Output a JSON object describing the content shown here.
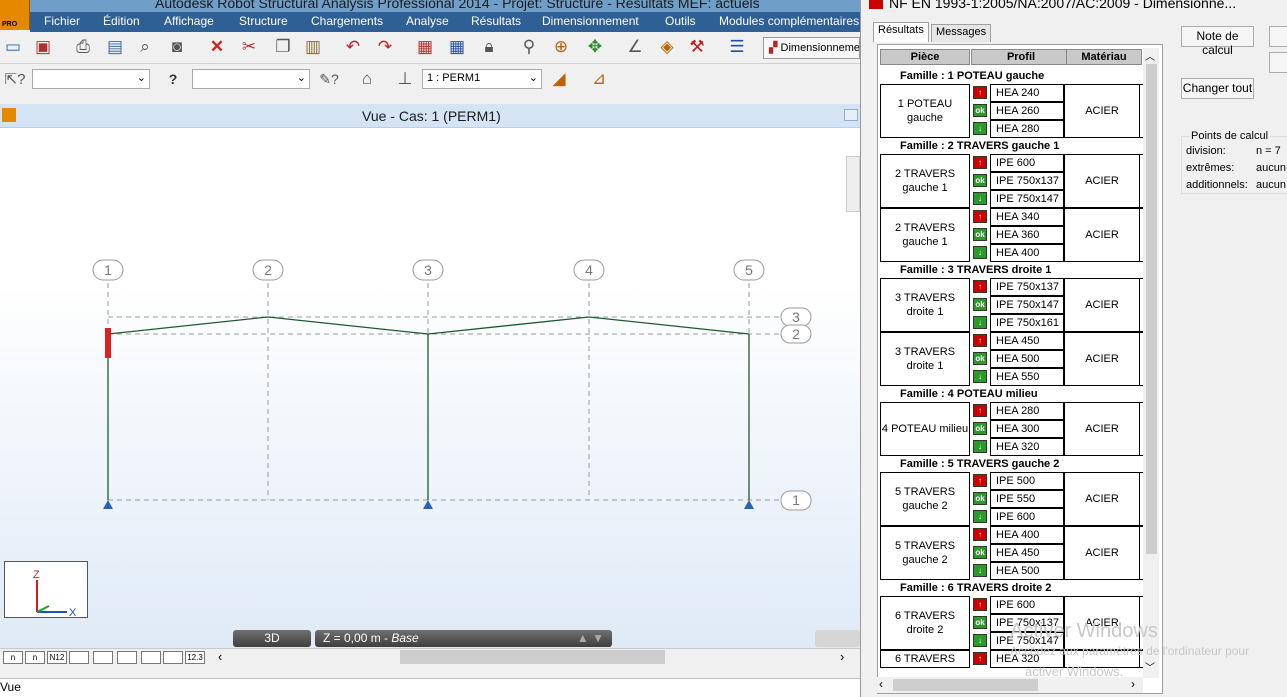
{
  "window": {
    "title": "Autodesk Robot Structural Analysis Professional 2014 - Projet: Structure - Résultats MEF: actuels",
    "logo_text": "PRO"
  },
  "menu": [
    "Fichier",
    "Édition",
    "Affichage",
    "Structure",
    "Chargements",
    "Analyse",
    "Résultats",
    "Dimensionnement",
    "Outils",
    "Modules complémentaires"
  ],
  "toolbar": {
    "dimension_button": "Dimensionnement",
    "combo1": "",
    "combo2": "",
    "case_combo": "1 : PERM1"
  },
  "view": {
    "title": "Vue - Cas: 1 (PERM1)",
    "mode_3d": "3D",
    "z_level": "Z = 0,00 m",
    "z_name": "Base",
    "axis_z": "Z",
    "axis_x": "X",
    "axis_y": "Y",
    "col_axes": [
      "1",
      "2",
      "3",
      "4",
      "5"
    ],
    "row_axes": [
      "3",
      "2",
      "1"
    ]
  },
  "status_icons": [
    "n",
    "n",
    "N12",
    "",
    "",
    "",
    "",
    "",
    "12.3"
  ],
  "command_line": "Vue",
  "panel": {
    "title": "NF EN 1993-1:2005/NA:2007/AC:2009 - Dimensionne...",
    "tabs": [
      "Résultats",
      "Messages"
    ],
    "headers": {
      "piece": "Pièce",
      "profil": "Profil",
      "materiau": "Matériau"
    },
    "families": [
      {
        "title": "Famille :  1  POTEAU gauche",
        "groups": [
          {
            "piece": [
              "1  POTEAU",
              "gauche"
            ],
            "material": "ACIER",
            "profiles": [
              [
                "up",
                "HEA 240"
              ],
              [
                "ok",
                "HEA 260"
              ],
              [
                "dn",
                "HEA 280"
              ]
            ]
          }
        ]
      },
      {
        "title": "Famille :  2  TRAVERS gauche 1",
        "groups": [
          {
            "piece": [
              "2  TRAVERS",
              "gauche 1"
            ],
            "material": "ACIER",
            "profiles": [
              [
                "up",
                "IPE 600"
              ],
              [
                "ok",
                "IPE 750x137"
              ],
              [
                "dn",
                "IPE 750x147"
              ]
            ]
          },
          {
            "piece": [
              "2  TRAVERS",
              "gauche 1"
            ],
            "material": "ACIER",
            "profiles": [
              [
                "up",
                "HEA 340"
              ],
              [
                "ok",
                "HEA 360"
              ],
              [
                "dn",
                "HEA 400"
              ]
            ]
          }
        ]
      },
      {
        "title": "Famille :  3  TRAVERS droite 1",
        "groups": [
          {
            "piece": [
              "3  TRAVERS",
              "droite 1"
            ],
            "material": "ACIER",
            "profiles": [
              [
                "up",
                "IPE 750x137"
              ],
              [
                "ok",
                "IPE 750x147"
              ],
              [
                "dn",
                "IPE 750x161"
              ]
            ]
          },
          {
            "piece": [
              "3  TRAVERS",
              "droite 1"
            ],
            "material": "ACIER",
            "profiles": [
              [
                "up",
                "HEA 450"
              ],
              [
                "ok",
                "HEA 500"
              ],
              [
                "dn",
                "HEA 550"
              ]
            ]
          }
        ]
      },
      {
        "title": "Famille :  4  POTEAU milieu",
        "groups": [
          {
            "piece": [
              "4  POTEAU milieu"
            ],
            "material": "ACIER",
            "profiles": [
              [
                "up",
                "HEA 280"
              ],
              [
                "ok",
                "HEA 300"
              ],
              [
                "dn",
                "HEA 320"
              ]
            ]
          }
        ]
      },
      {
        "title": "Famille :  5  TRAVERS gauche 2",
        "groups": [
          {
            "piece": [
              "5  TRAVERS",
              "gauche 2"
            ],
            "material": "ACIER",
            "profiles": [
              [
                "up",
                "IPE 500"
              ],
              [
                "ok",
                "IPE 550"
              ],
              [
                "dn",
                "IPE 600"
              ]
            ]
          },
          {
            "piece": [
              "5  TRAVERS",
              "gauche 2"
            ],
            "material": "ACIER",
            "profiles": [
              [
                "up",
                "HEA 400"
              ],
              [
                "ok",
                "HEA 450"
              ],
              [
                "dn",
                "HEA 500"
              ]
            ]
          }
        ]
      },
      {
        "title": "Famille :  6  TRAVERS droite 2",
        "groups": [
          {
            "piece": [
              "6  TRAVERS",
              "droite 2"
            ],
            "material": "ACIER",
            "profiles": [
              [
                "up",
                "IPE 600"
              ],
              [
                "ok",
                "IPE 750x137"
              ],
              [
                "dn",
                "IPE 750x147"
              ]
            ]
          },
          {
            "piece": [
              "6  TRAVERS"
            ],
            "material": "",
            "profiles": [
              [
                "up",
                "HEA 320"
              ]
            ]
          }
        ]
      }
    ],
    "buttons": {
      "note": "Note de calcul",
      "change_all": "Changer tout"
    },
    "calc_points": {
      "title": "Points de calcul",
      "rows": [
        [
          "division:",
          "n = 7"
        ],
        [
          "extrêmes:",
          "aucun"
        ],
        [
          "additionnels:",
          "aucun"
        ]
      ]
    },
    "watermark": {
      "line1": "Activer Windows",
      "line2": "Accédez aux paramètres de l'ordinateur pour",
      "line3": "activer Windows."
    }
  },
  "icons": {
    "up": "arrow-up-icon",
    "ok": "ok-icon",
    "dn": "arrow-down-icon"
  },
  "colors": {
    "frame": "#1f5a2e",
    "support": "#2b62b8",
    "highlight": "#e02020",
    "menubar": "#2e5f95",
    "title": "#6f9fc9"
  }
}
